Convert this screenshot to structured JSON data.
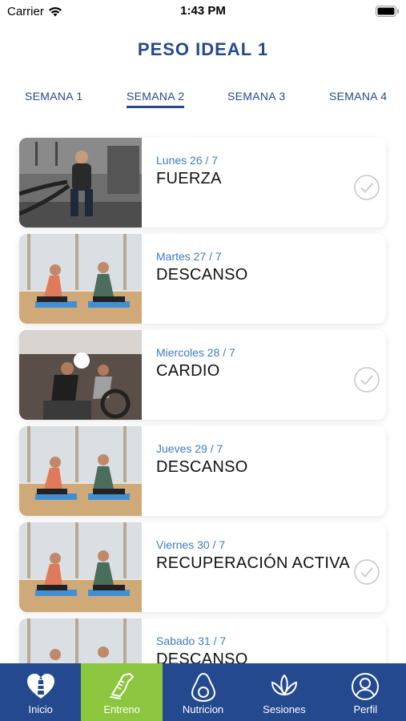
{
  "status": {
    "carrier": "Carrier",
    "time": "1:43 PM"
  },
  "title": "PESO IDEAL 1",
  "tabs": [
    {
      "label": "SEMANA 1"
    },
    {
      "label": "SEMANA 2",
      "active": true
    },
    {
      "label": "SEMANA 3"
    },
    {
      "label": "SEMANA 4"
    }
  ],
  "days": [
    {
      "date": "Lunes 26 / 7",
      "name": "FUERZA",
      "completed": true,
      "image": "battle-ropes-photo"
    },
    {
      "date": "Martes 27 / 7",
      "name": "DESCANSO",
      "completed": false,
      "image": "stretching-photo"
    },
    {
      "date": "Miercoles 28 / 7",
      "name": "CARDIO",
      "completed": true,
      "image": "cycling-photo"
    },
    {
      "date": "Jueves 29 / 7",
      "name": "DESCANSO",
      "completed": false,
      "image": "stretching-photo"
    },
    {
      "date": "Viernes 30 / 7",
      "name": "RECUPERACIÓN ACTIVA",
      "completed": true,
      "image": "stretching-photo"
    },
    {
      "date": "Sabado 31 / 7",
      "name": "DESCANSO",
      "completed": false,
      "image": "stretching-photo"
    }
  ],
  "nav": [
    {
      "label": "Inicio",
      "icon": "heart-lighthouse-icon"
    },
    {
      "label": "Entreno",
      "icon": "sneaker-icon",
      "active": true
    },
    {
      "label": "Nutricion",
      "icon": "avocado-icon"
    },
    {
      "label": "Sesiones",
      "icon": "lotus-icon"
    },
    {
      "label": "Perfil",
      "icon": "user-icon"
    }
  ],
  "colors": {
    "brand": "#24498f",
    "accent": "#8cc63e",
    "date": "#3b7cc2"
  }
}
